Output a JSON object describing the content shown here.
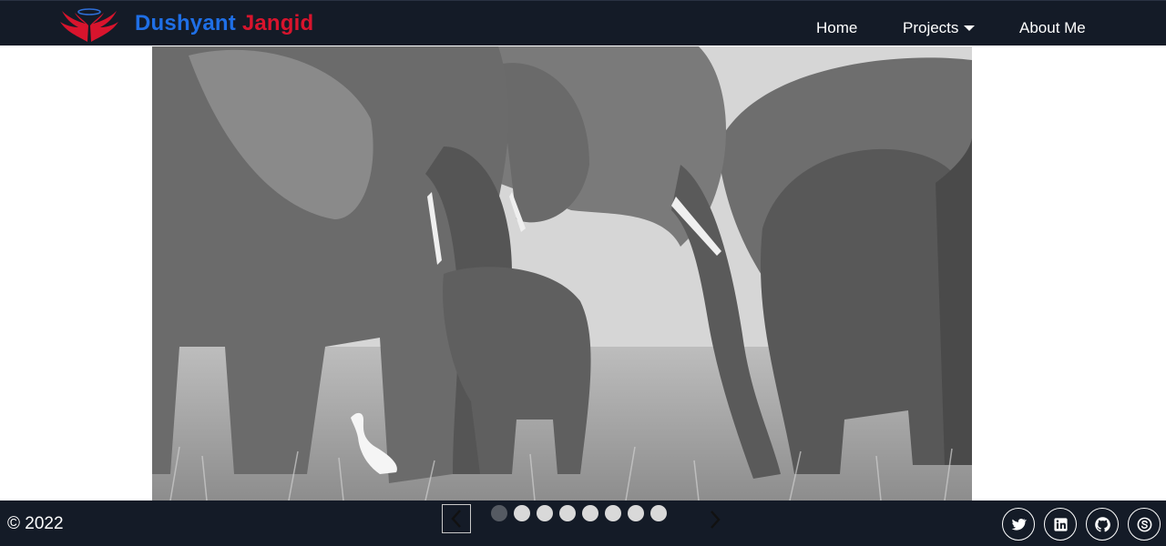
{
  "header": {
    "brand_first": "Dushyant",
    "brand_last": "Jangid",
    "nav": {
      "home": "Home",
      "projects": "Projects",
      "about": "About Me"
    },
    "logo_icon": "winged-emblem-icon",
    "colors": {
      "background": "#141b27",
      "brand_first": "#1f6fe6",
      "brand_last": "#d8142d"
    }
  },
  "carousel": {
    "active_index": 0,
    "slide_count": 8,
    "prev_icon": "chevron-left-icon",
    "next_icon": "chevron-right-icon"
  },
  "footer": {
    "copyright": "© 2022",
    "socials": [
      "twitter-icon",
      "linkedin-icon",
      "github-icon",
      "skype-icon"
    ]
  }
}
